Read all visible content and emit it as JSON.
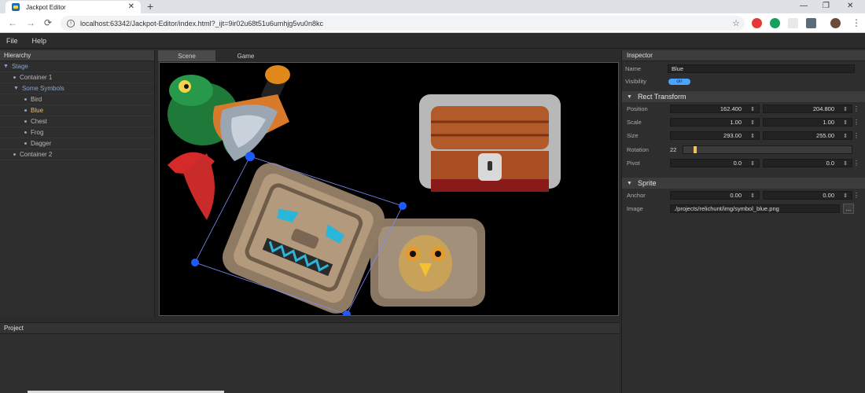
{
  "browser": {
    "tab_title": "Jackpot Editor",
    "tab_close": "✕",
    "new_tab": "+",
    "url": "localhost:63342/Jackpot-Editor/index.html?_ijt=9ir02u68t51u6umhjg5vu0n8kc",
    "back": "←",
    "forward": "→",
    "reload": "⟳",
    "info": "i",
    "star": "☆",
    "win_min": "—",
    "win_max": "❐",
    "win_close": "✕",
    "menu_dots": "⋮"
  },
  "menubar": {
    "file": "File",
    "help": "Help"
  },
  "hierarchy": {
    "title": "Hierarchy",
    "items": [
      {
        "label": "Stage",
        "arrow": "▼",
        "state": "expanded",
        "depth": 0
      },
      {
        "label": "Container 1",
        "state": "collapsed",
        "depth": 1
      },
      {
        "label": "Some Symbols",
        "arrow": "▼",
        "state": "expanded",
        "depth": 1
      },
      {
        "label": "Bird",
        "state": "normal",
        "depth": 2
      },
      {
        "label": "Blue",
        "state": "selected",
        "depth": 2
      },
      {
        "label": "Chest",
        "state": "normal",
        "depth": 2
      },
      {
        "label": "Frog",
        "state": "normal",
        "depth": 2
      },
      {
        "label": "Dagger",
        "state": "normal",
        "depth": 2
      },
      {
        "label": "Container 2",
        "state": "collapsed",
        "depth": 1
      }
    ]
  },
  "scene": {
    "tabs": [
      {
        "label": "Scene",
        "active": true
      },
      {
        "label": "Game",
        "active": false
      }
    ]
  },
  "project": {
    "title": "Project"
  },
  "inspector": {
    "title": "Inspector",
    "name_label": "Name",
    "name_value": "Blue",
    "visibility_label": "Visibility",
    "visibility_value": "on",
    "rect_transform": {
      "title": "Rect Transform",
      "caret": "▼",
      "position_label": "Position",
      "position_x": "162.400",
      "position_y": "204.800",
      "scale_label": "Scale",
      "scale_x": "1.00",
      "scale_y": "1.00",
      "size_label": "Size",
      "size_x": "293.00",
      "size_y": "255.00",
      "rotation_label": "Rotation",
      "rotation_value": "22",
      "rotation_fraction": 0.06,
      "pivot_label": "Pivot",
      "pivot_x": "0.0",
      "pivot_y": "0.0"
    },
    "sprite": {
      "title": "Sprite",
      "caret": "▼",
      "anchor_label": "Anchor",
      "anchor_x": "0.00",
      "anchor_y": "0.00",
      "image_label": "Image",
      "image_value": "./projects/relichunt/img/symbol_blue.png",
      "browse": "..."
    },
    "spin": "⇕",
    "kebab": "⋮"
  },
  "colors": {
    "accent": "#4aa3ff",
    "selected_text": "#f0c060",
    "tree_blue": "#8aa5c8"
  }
}
